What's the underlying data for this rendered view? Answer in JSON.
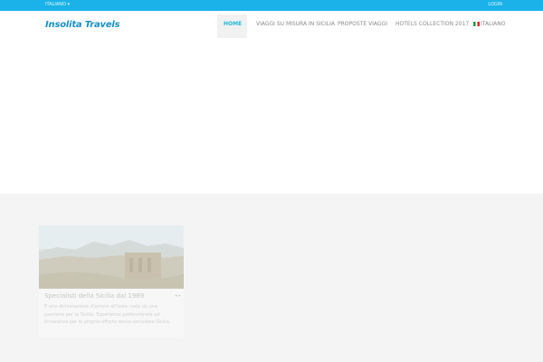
{
  "topbar": {
    "language": "ITALIANO ▾",
    "login": "LOGIN",
    "color": "#1ab2e8"
  },
  "header": {
    "logo": "Insolita Travels"
  },
  "nav": {
    "items": [
      {
        "label": "HOME",
        "active": true
      },
      {
        "label": "VIAGGI SU MISURA IN SICILIA",
        "active": false
      },
      {
        "label": "PROPOSTE VIAGGI",
        "active": false
      },
      {
        "label": "HOTELS COLLECTION 2017",
        "active": false
      },
      {
        "label": "ITALIANO",
        "active": false,
        "icon": "italy-flag-icon"
      }
    ]
  },
  "card": {
    "title": "Specialisti della Sicilia dal 1989",
    "text": "È una dichiarazione d'amore all'isola: nata da una passione per la Sicilia, Esperienza professionale ed innovativa per le proprie offerte senza escludere Sicilia."
  },
  "colors": {
    "accent": "#22b8d8",
    "logo": "#1890c4",
    "section_bg": "#f4f4f4"
  }
}
